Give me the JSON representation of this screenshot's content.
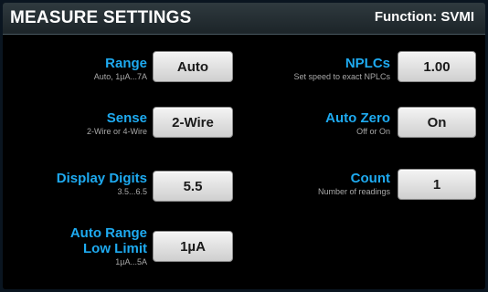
{
  "header": {
    "title": "MEASURE SETTINGS",
    "function": "Function: SVMI"
  },
  "settings": {
    "range": {
      "label": "Range",
      "hint": "Auto, 1µA...7A",
      "value": "Auto"
    },
    "sense": {
      "label": "Sense",
      "hint": "2-Wire or 4-Wire",
      "value": "2-Wire"
    },
    "display_digits": {
      "label": "Display Digits",
      "hint": "3.5...6.5",
      "value": "5.5"
    },
    "auto_range_low_limit": {
      "label_line1": "Auto Range",
      "label_line2": "Low Limit",
      "hint": "1µA...5A",
      "value": "1µA"
    },
    "nplcs": {
      "label": "NPLCs",
      "hint": "Set speed to exact NPLCs",
      "value": "1.00"
    },
    "auto_zero": {
      "label": "Auto Zero",
      "hint": "Off or On",
      "value": "On"
    },
    "count": {
      "label": "Count",
      "hint": "Number of readings",
      "value": "1"
    }
  }
}
